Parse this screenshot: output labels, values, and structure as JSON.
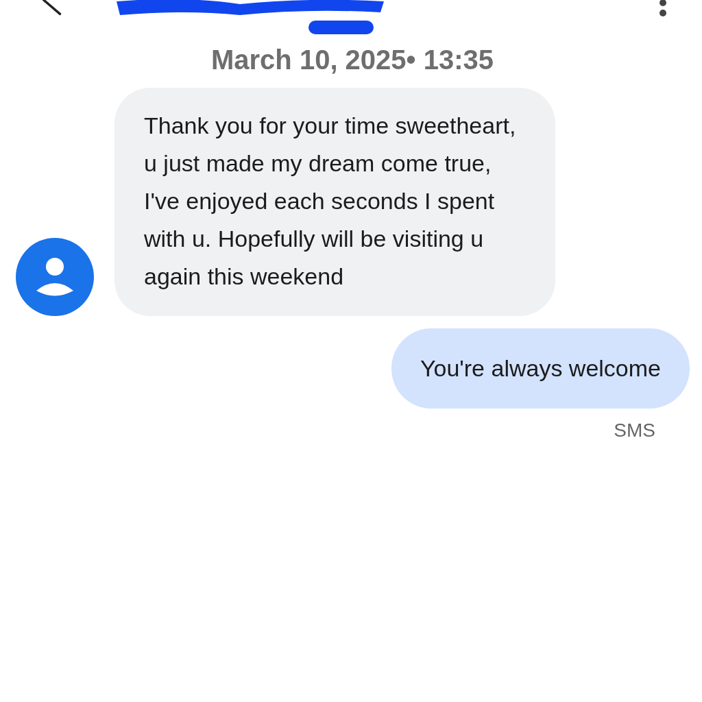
{
  "header": {
    "date": "March 10, 2025• 13:35"
  },
  "messages": [
    {
      "kind": "incoming",
      "text": "Thank you for your time sweetheart,  u just made my dream come true, I've enjoyed each seconds I spent with u. Hopefully will be visiting u again this weekend"
    },
    {
      "kind": "outgoing",
      "text": "You're always welcome",
      "meta": "SMS"
    }
  ]
}
